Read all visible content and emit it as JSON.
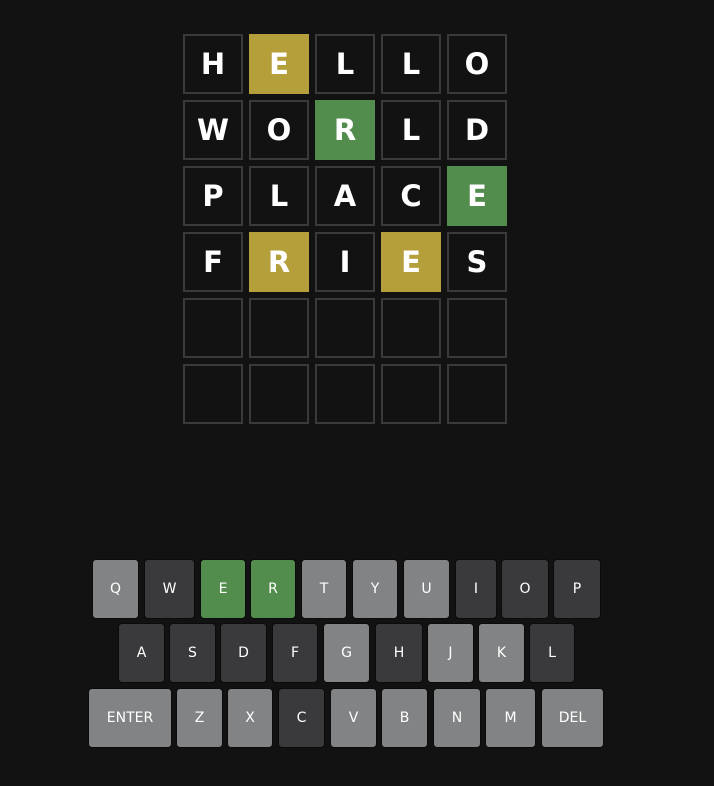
{
  "colors": {
    "background": "#121212",
    "tile_border": "#3a3a3c",
    "present": "#b59f3b",
    "correct": "#538d4e",
    "absent": "#3a3a3c",
    "unused": "#818384",
    "text": "#ffffff"
  },
  "board": {
    "rows": [
      [
        {
          "letter": "H",
          "state": "filled"
        },
        {
          "letter": "E",
          "state": "present"
        },
        {
          "letter": "L",
          "state": "filled"
        },
        {
          "letter": "L",
          "state": "filled"
        },
        {
          "letter": "O",
          "state": "filled"
        }
      ],
      [
        {
          "letter": "W",
          "state": "filled"
        },
        {
          "letter": "O",
          "state": "filled"
        },
        {
          "letter": "R",
          "state": "correct"
        },
        {
          "letter": "L",
          "state": "filled"
        },
        {
          "letter": "D",
          "state": "filled"
        }
      ],
      [
        {
          "letter": "P",
          "state": "filled"
        },
        {
          "letter": "L",
          "state": "filled"
        },
        {
          "letter": "A",
          "state": "filled"
        },
        {
          "letter": "C",
          "state": "filled"
        },
        {
          "letter": "E",
          "state": "correct"
        }
      ],
      [
        {
          "letter": "F",
          "state": "filled"
        },
        {
          "letter": "R",
          "state": "present"
        },
        {
          "letter": "I",
          "state": "filled"
        },
        {
          "letter": "E",
          "state": "present"
        },
        {
          "letter": "S",
          "state": "filled"
        }
      ],
      [
        {
          "letter": "",
          "state": "empty"
        },
        {
          "letter": "",
          "state": "empty"
        },
        {
          "letter": "",
          "state": "empty"
        },
        {
          "letter": "",
          "state": "empty"
        },
        {
          "letter": "",
          "state": "empty"
        }
      ],
      [
        {
          "letter": "",
          "state": "empty"
        },
        {
          "letter": "",
          "state": "empty"
        },
        {
          "letter": "",
          "state": "empty"
        },
        {
          "letter": "",
          "state": "empty"
        },
        {
          "letter": "",
          "state": "empty"
        }
      ]
    ]
  },
  "keyboard": {
    "rows": [
      [
        {
          "label": "Q",
          "state": "unused"
        },
        {
          "label": "W",
          "state": "absent"
        },
        {
          "label": "E",
          "state": "correct"
        },
        {
          "label": "R",
          "state": "correct"
        },
        {
          "label": "T",
          "state": "unused"
        },
        {
          "label": "Y",
          "state": "unused"
        },
        {
          "label": "U",
          "state": "unused"
        },
        {
          "label": "I",
          "state": "absent"
        },
        {
          "label": "O",
          "state": "absent"
        },
        {
          "label": "P",
          "state": "absent"
        }
      ],
      [
        {
          "label": "A",
          "state": "absent"
        },
        {
          "label": "S",
          "state": "absent"
        },
        {
          "label": "D",
          "state": "absent"
        },
        {
          "label": "F",
          "state": "absent"
        },
        {
          "label": "G",
          "state": "unused"
        },
        {
          "label": "H",
          "state": "absent"
        },
        {
          "label": "J",
          "state": "unused"
        },
        {
          "label": "K",
          "state": "unused"
        },
        {
          "label": "L",
          "state": "absent"
        }
      ],
      [
        {
          "label": "ENTER",
          "state": "unused"
        },
        {
          "label": "Z",
          "state": "unused"
        },
        {
          "label": "X",
          "state": "unused"
        },
        {
          "label": "C",
          "state": "absent"
        },
        {
          "label": "V",
          "state": "unused"
        },
        {
          "label": "B",
          "state": "unused"
        },
        {
          "label": "N",
          "state": "unused"
        },
        {
          "label": "M",
          "state": "unused"
        },
        {
          "label": "DEL",
          "state": "unused"
        }
      ]
    ]
  }
}
